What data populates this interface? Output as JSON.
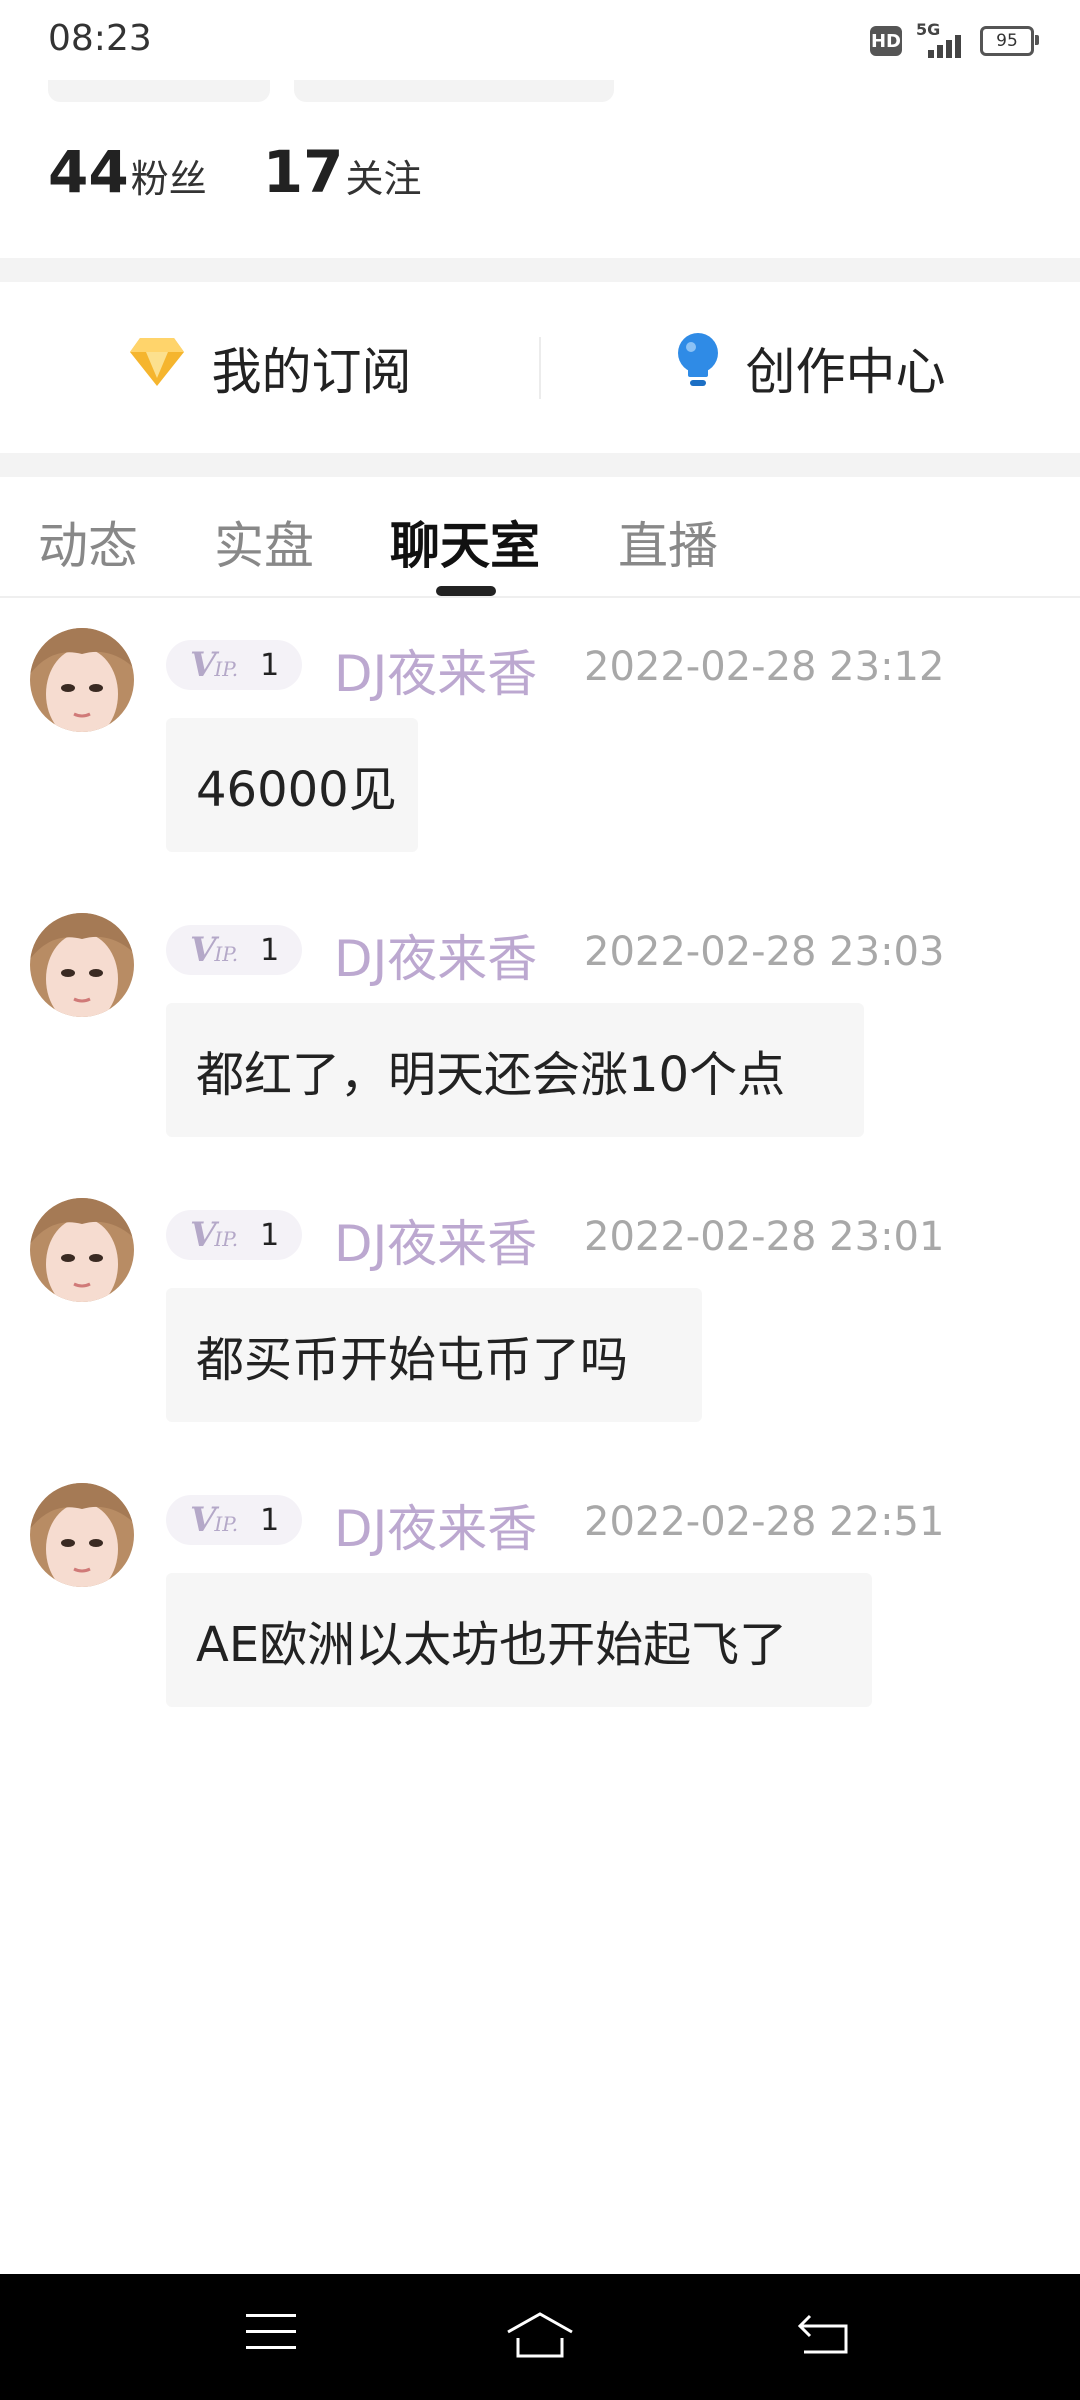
{
  "status_bar": {
    "time": "08:23",
    "hd": "HD",
    "network": "5G",
    "battery": "95"
  },
  "stats": {
    "fans_count": "44",
    "fans_label": "粉丝",
    "following_count": "17",
    "following_label": "关注"
  },
  "entries": [
    {
      "label": "我的订阅",
      "icon": "diamond-icon"
    },
    {
      "label": "创作中心",
      "icon": "lightbulb-icon"
    }
  ],
  "tabs": [
    {
      "label": "动态",
      "active": false
    },
    {
      "label": "实盘",
      "active": false
    },
    {
      "label": "聊天室",
      "active": true
    },
    {
      "label": "直播",
      "active": false
    }
  ],
  "messages": [
    {
      "vip_level": "1",
      "username": "DJ夜来香",
      "time": "2022-02-28 23:12",
      "text": "46000见"
    },
    {
      "vip_level": "1",
      "username": "DJ夜来香",
      "time": "2022-02-28 23:03",
      "text": "都红了，明天还会涨10个点"
    },
    {
      "vip_level": "1",
      "username": "DJ夜来香",
      "time": "2022-02-28 23:01",
      "text": "都买币开始屯币了吗"
    },
    {
      "vip_level": "1",
      "username": "DJ夜来香",
      "time": "2022-02-28 22:51",
      "text": "AE欧洲以太坊也开始起飞了"
    }
  ],
  "vip_badge": {
    "v": "V",
    "ip": "IP."
  },
  "colors": {
    "username": "#bca8d0",
    "entry_diamond": "#f5b52e",
    "entry_bulb": "#2f8be6"
  }
}
